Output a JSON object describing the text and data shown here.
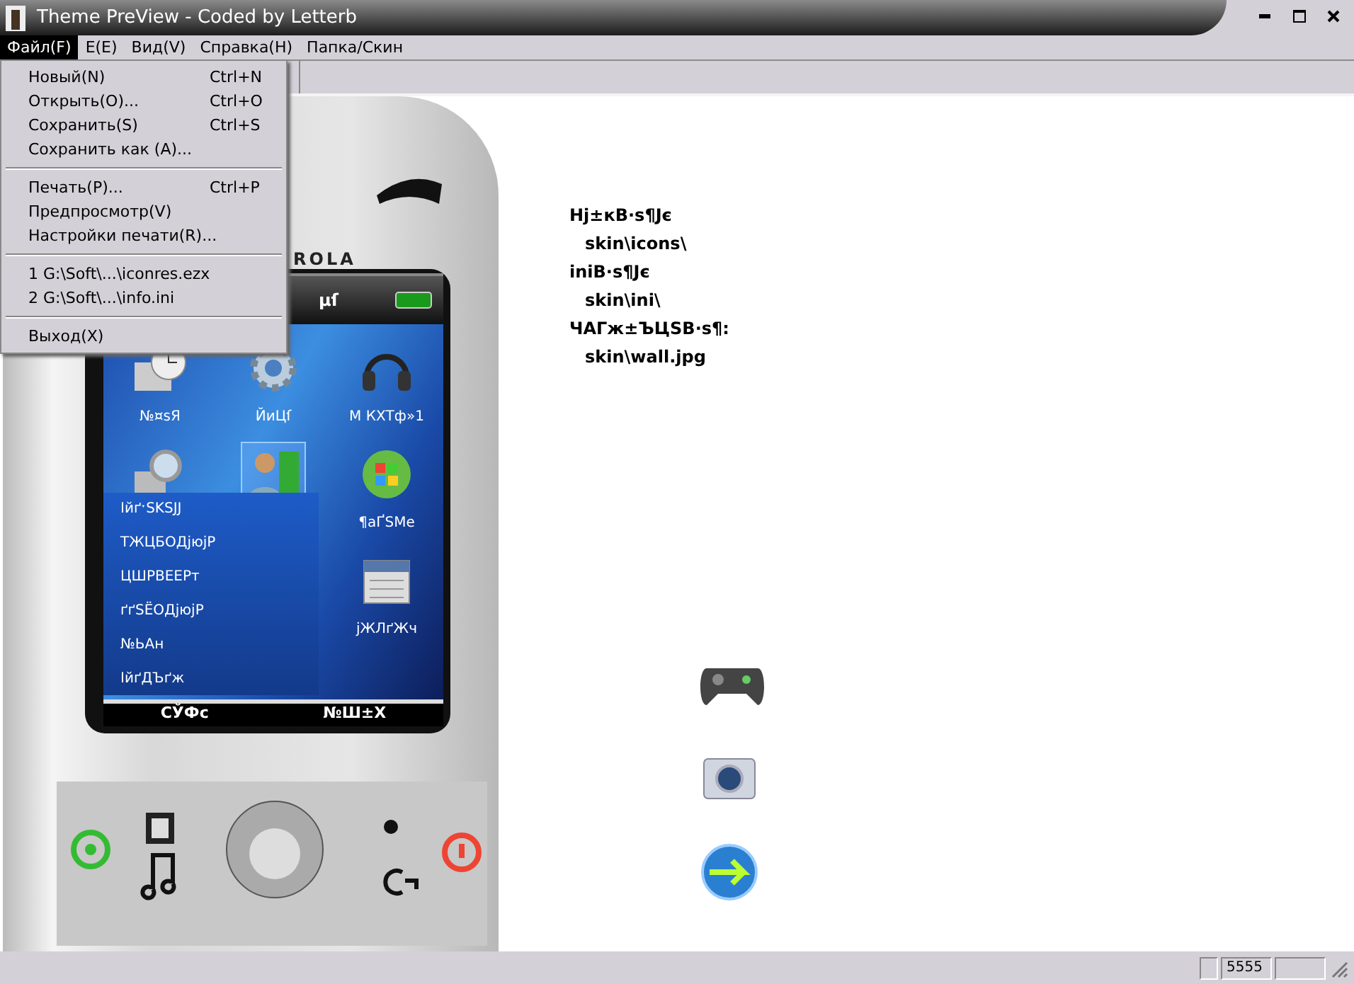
{
  "window": {
    "title": "Theme PreView - Coded by Letterb"
  },
  "menu_bar": [
    {
      "label": "Файл(F)",
      "selected": true
    },
    {
      "label": "E(E)",
      "selected": false
    },
    {
      "label": "Вид(V)",
      "selected": false
    },
    {
      "label": "Справка(H)",
      "selected": false
    },
    {
      "label": "Папка/Скин",
      "selected": false
    }
  ],
  "file_menu": [
    {
      "kind": "item",
      "label": "Новый(N)",
      "shortcut": "Ctrl+N"
    },
    {
      "kind": "item",
      "label": "Открыть(O)...",
      "shortcut": "Ctrl+O"
    },
    {
      "kind": "item",
      "label": "Сохранить(S)",
      "shortcut": "Ctrl+S"
    },
    {
      "kind": "item",
      "label": "Сохранить как (A)..."
    },
    {
      "kind": "separator"
    },
    {
      "kind": "item",
      "label": "Печать(P)...",
      "shortcut": "Ctrl+P"
    },
    {
      "kind": "item",
      "label": "Предпросмотр(V)"
    },
    {
      "kind": "item",
      "label": "Настройки печати(R)..."
    },
    {
      "kind": "separator"
    },
    {
      "kind": "item",
      "label": "1 G:\\Soft\\...\\iconres.ezx"
    },
    {
      "kind": "item",
      "label": "2 G:\\Soft\\...\\info.ini"
    },
    {
      "kind": "separator"
    },
    {
      "kind": "item",
      "label": "Выход(X)"
    }
  ],
  "phone": {
    "brand": "ROLA",
    "screen_title": "µſ",
    "grid": [
      {
        "label": "№¤ѕЯ",
        "selected": false
      },
      {
        "label": "ЙиЦſ",
        "selected": false
      },
      {
        "label": "М КХТф»1",
        "selected": false
      },
      {
        "selected": false
      },
      {
        "selected": true
      },
      {
        "label": "¶аҐЅМе",
        "selected": false
      },
      {
        "label": "јЖЛґЖч",
        "selected": false
      }
    ],
    "popup_menu": [
      "ІйґˑSKSJJ",
      "ТЖЦБОДјюјР",
      "ЦШРВЕЕРт",
      "ґґSЁОДјюјР",
      "№ЬАн",
      "ІйґДЪґж"
    ],
    "soft_keys": [
      "СЎФс",
      "№Ш±Х"
    ]
  },
  "info_lines": [
    {
      "kind": "heading",
      "text": "Hj±кB·s¶Jє"
    },
    {
      "kind": "value",
      "text": "skin\\icons\\"
    },
    {
      "kind": "heading",
      "text": "iniB·s¶Jє"
    },
    {
      "kind": "value",
      "text": "skin\\ini\\"
    },
    {
      "kind": "heading",
      "text": "ЧАГж±ЪЦSB·s¶:"
    },
    {
      "kind": "value",
      "text": "skin\\wall.jpg"
    }
  ],
  "status_bar": {
    "panel_2": "5555"
  }
}
